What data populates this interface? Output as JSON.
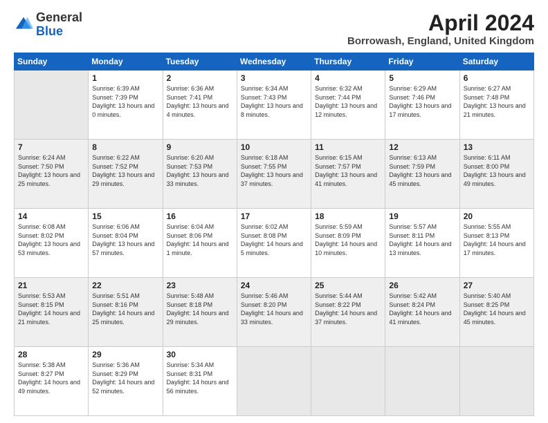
{
  "logo": {
    "general": "General",
    "blue": "Blue"
  },
  "title": {
    "month": "April 2024",
    "location": "Borrowash, England, United Kingdom"
  },
  "days_of_week": [
    "Sunday",
    "Monday",
    "Tuesday",
    "Wednesday",
    "Thursday",
    "Friday",
    "Saturday"
  ],
  "weeks": [
    [
      {
        "day": "",
        "empty": true
      },
      {
        "day": "1",
        "sunrise": "Sunrise: 6:39 AM",
        "sunset": "Sunset: 7:39 PM",
        "daylight": "Daylight: 13 hours and 0 minutes."
      },
      {
        "day": "2",
        "sunrise": "Sunrise: 6:36 AM",
        "sunset": "Sunset: 7:41 PM",
        "daylight": "Daylight: 13 hours and 4 minutes."
      },
      {
        "day": "3",
        "sunrise": "Sunrise: 6:34 AM",
        "sunset": "Sunset: 7:43 PM",
        "daylight": "Daylight: 13 hours and 8 minutes."
      },
      {
        "day": "4",
        "sunrise": "Sunrise: 6:32 AM",
        "sunset": "Sunset: 7:44 PM",
        "daylight": "Daylight: 13 hours and 12 minutes."
      },
      {
        "day": "5",
        "sunrise": "Sunrise: 6:29 AM",
        "sunset": "Sunset: 7:46 PM",
        "daylight": "Daylight: 13 hours and 17 minutes."
      },
      {
        "day": "6",
        "sunrise": "Sunrise: 6:27 AM",
        "sunset": "Sunset: 7:48 PM",
        "daylight": "Daylight: 13 hours and 21 minutes."
      }
    ],
    [
      {
        "day": "7",
        "sunrise": "Sunrise: 6:24 AM",
        "sunset": "Sunset: 7:50 PM",
        "daylight": "Daylight: 13 hours and 25 minutes."
      },
      {
        "day": "8",
        "sunrise": "Sunrise: 6:22 AM",
        "sunset": "Sunset: 7:52 PM",
        "daylight": "Daylight: 13 hours and 29 minutes."
      },
      {
        "day": "9",
        "sunrise": "Sunrise: 6:20 AM",
        "sunset": "Sunset: 7:53 PM",
        "daylight": "Daylight: 13 hours and 33 minutes."
      },
      {
        "day": "10",
        "sunrise": "Sunrise: 6:18 AM",
        "sunset": "Sunset: 7:55 PM",
        "daylight": "Daylight: 13 hours and 37 minutes."
      },
      {
        "day": "11",
        "sunrise": "Sunrise: 6:15 AM",
        "sunset": "Sunset: 7:57 PM",
        "daylight": "Daylight: 13 hours and 41 minutes."
      },
      {
        "day": "12",
        "sunrise": "Sunrise: 6:13 AM",
        "sunset": "Sunset: 7:59 PM",
        "daylight": "Daylight: 13 hours and 45 minutes."
      },
      {
        "day": "13",
        "sunrise": "Sunrise: 6:11 AM",
        "sunset": "Sunset: 8:00 PM",
        "daylight": "Daylight: 13 hours and 49 minutes."
      }
    ],
    [
      {
        "day": "14",
        "sunrise": "Sunrise: 6:08 AM",
        "sunset": "Sunset: 8:02 PM",
        "daylight": "Daylight: 13 hours and 53 minutes."
      },
      {
        "day": "15",
        "sunrise": "Sunrise: 6:06 AM",
        "sunset": "Sunset: 8:04 PM",
        "daylight": "Daylight: 13 hours and 57 minutes."
      },
      {
        "day": "16",
        "sunrise": "Sunrise: 6:04 AM",
        "sunset": "Sunset: 8:06 PM",
        "daylight": "Daylight: 14 hours and 1 minute."
      },
      {
        "day": "17",
        "sunrise": "Sunrise: 6:02 AM",
        "sunset": "Sunset: 8:08 PM",
        "daylight": "Daylight: 14 hours and 5 minutes."
      },
      {
        "day": "18",
        "sunrise": "Sunrise: 5:59 AM",
        "sunset": "Sunset: 8:09 PM",
        "daylight": "Daylight: 14 hours and 10 minutes."
      },
      {
        "day": "19",
        "sunrise": "Sunrise: 5:57 AM",
        "sunset": "Sunset: 8:11 PM",
        "daylight": "Daylight: 14 hours and 13 minutes."
      },
      {
        "day": "20",
        "sunrise": "Sunrise: 5:55 AM",
        "sunset": "Sunset: 8:13 PM",
        "daylight": "Daylight: 14 hours and 17 minutes."
      }
    ],
    [
      {
        "day": "21",
        "sunrise": "Sunrise: 5:53 AM",
        "sunset": "Sunset: 8:15 PM",
        "daylight": "Daylight: 14 hours and 21 minutes."
      },
      {
        "day": "22",
        "sunrise": "Sunrise: 5:51 AM",
        "sunset": "Sunset: 8:16 PM",
        "daylight": "Daylight: 14 hours and 25 minutes."
      },
      {
        "day": "23",
        "sunrise": "Sunrise: 5:48 AM",
        "sunset": "Sunset: 8:18 PM",
        "daylight": "Daylight: 14 hours and 29 minutes."
      },
      {
        "day": "24",
        "sunrise": "Sunrise: 5:46 AM",
        "sunset": "Sunset: 8:20 PM",
        "daylight": "Daylight: 14 hours and 33 minutes."
      },
      {
        "day": "25",
        "sunrise": "Sunrise: 5:44 AM",
        "sunset": "Sunset: 8:22 PM",
        "daylight": "Daylight: 14 hours and 37 minutes."
      },
      {
        "day": "26",
        "sunrise": "Sunrise: 5:42 AM",
        "sunset": "Sunset: 8:24 PM",
        "daylight": "Daylight: 14 hours and 41 minutes."
      },
      {
        "day": "27",
        "sunrise": "Sunrise: 5:40 AM",
        "sunset": "Sunset: 8:25 PM",
        "daylight": "Daylight: 14 hours and 45 minutes."
      }
    ],
    [
      {
        "day": "28",
        "sunrise": "Sunrise: 5:38 AM",
        "sunset": "Sunset: 8:27 PM",
        "daylight": "Daylight: 14 hours and 49 minutes."
      },
      {
        "day": "29",
        "sunrise": "Sunrise: 5:36 AM",
        "sunset": "Sunset: 8:29 PM",
        "daylight": "Daylight: 14 hours and 52 minutes."
      },
      {
        "day": "30",
        "sunrise": "Sunrise: 5:34 AM",
        "sunset": "Sunset: 8:31 PM",
        "daylight": "Daylight: 14 hours and 56 minutes."
      },
      {
        "day": "",
        "empty": true
      },
      {
        "day": "",
        "empty": true
      },
      {
        "day": "",
        "empty": true
      },
      {
        "day": "",
        "empty": true
      }
    ]
  ]
}
